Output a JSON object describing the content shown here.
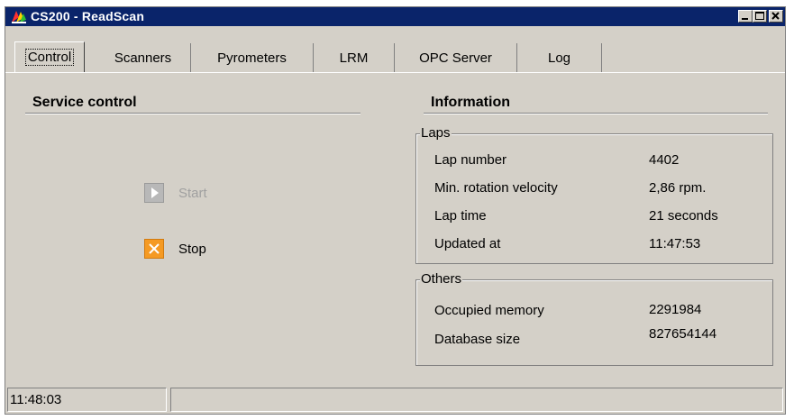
{
  "window": {
    "title": "CS200 - ReadScan"
  },
  "tabs": [
    {
      "label": "Control",
      "active": true
    },
    {
      "label": "Scanners"
    },
    {
      "label": "Pyrometers"
    },
    {
      "label": "LRM"
    },
    {
      "label": "OPC Server"
    },
    {
      "label": "Log"
    }
  ],
  "service_control": {
    "title": "Service control",
    "start_label": "Start",
    "stop_label": "Stop"
  },
  "information": {
    "title": "Information",
    "laps": {
      "label": "Laps",
      "rows": [
        {
          "label": "Lap number",
          "value": "4402"
        },
        {
          "label": "Min. rotation velocity",
          "value": "2,86 rpm."
        },
        {
          "label": "Lap time",
          "value": "21 seconds"
        },
        {
          "label": "Updated at",
          "value": "11:47:53"
        }
      ]
    },
    "others": {
      "label": "Others",
      "rows": [
        {
          "label": "Occupied memory",
          "value": "2291984"
        },
        {
          "label": "Database size",
          "value": "827654144"
        }
      ]
    }
  },
  "statusbar": {
    "time": "11:48:03",
    "message": ""
  },
  "colors": {
    "titlebar": "#0a246a",
    "face": "#d4d0c8",
    "stop_icon": "#f59a23"
  }
}
